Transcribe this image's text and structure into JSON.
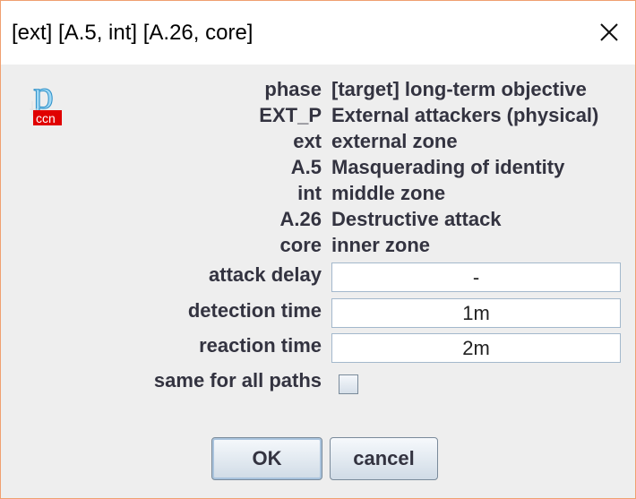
{
  "window": {
    "title": "[ext] [A.5, int] [A.26, core]"
  },
  "logo": {
    "letter": "p",
    "badge": "ccn"
  },
  "info": [
    {
      "label": "phase",
      "value": "[target] long-term objective"
    },
    {
      "label": "EXT_P",
      "value": "External attackers (physical)"
    },
    {
      "label": "ext",
      "value": "external zone"
    },
    {
      "label": "A.5",
      "value": "Masquerading of identity"
    },
    {
      "label": "int",
      "value": "middle zone"
    },
    {
      "label": "A.26",
      "value": "Destructive attack"
    },
    {
      "label": "core",
      "value": "inner zone"
    }
  ],
  "fields": {
    "attack_delay": {
      "label": "attack delay",
      "value": "-"
    },
    "detection_time": {
      "label": "detection time",
      "value": "1m"
    },
    "reaction_time": {
      "label": "reaction time",
      "value": "2m"
    }
  },
  "same_for_all_paths": {
    "label": "same for all paths",
    "checked": false
  },
  "buttons": {
    "ok": "OK",
    "cancel": "cancel"
  },
  "icons": {
    "close": "close-icon",
    "logo": "pilar-ccn-logo-icon"
  },
  "colors": {
    "badge_red": "#e00000",
    "field_border": "#a3b8cc",
    "text": "#333340"
  }
}
